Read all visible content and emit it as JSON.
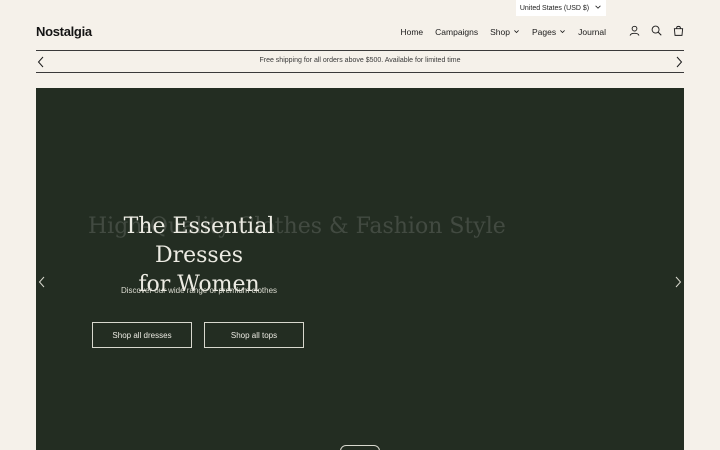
{
  "currency": {
    "label": "United States (USD $)"
  },
  "header": {
    "logo": "Nostalgia",
    "nav": [
      {
        "label": "Home",
        "has_dropdown": false
      },
      {
        "label": "Campaigns",
        "has_dropdown": false
      },
      {
        "label": "Shop",
        "has_dropdown": true
      },
      {
        "label": "Pages",
        "has_dropdown": true
      },
      {
        "label": "Journal",
        "has_dropdown": false
      }
    ],
    "icons": [
      "account-icon",
      "search-icon",
      "cart-icon"
    ]
  },
  "announcement": {
    "text": "Free shipping for all orders above $500. Available for limited time"
  },
  "hero": {
    "ghost_heading": "High-Quality Clothes & Fashion Style",
    "heading_line1": "The Essential Dresses",
    "heading_line2": "for Women",
    "subtitle": "Discover our wide range of premium clothes",
    "buttons": [
      {
        "label": "Shop all dresses"
      },
      {
        "label": "Shop all tops"
      }
    ]
  },
  "colors": {
    "page_bg": "#f5f1ea",
    "hero_bg": "#232d22",
    "text_dark": "#1c1c1c",
    "text_light": "#ecebe3"
  }
}
